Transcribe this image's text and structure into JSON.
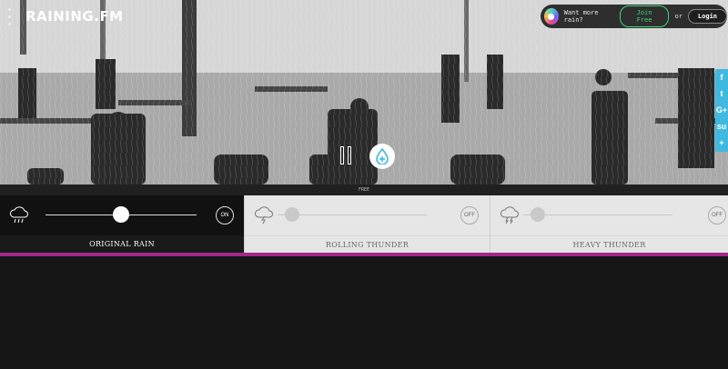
{
  "brand": {
    "logo_text": "RAINING.FM"
  },
  "account": {
    "promo_text": "Want more rain?",
    "join_label": "Join Free",
    "or_text": "or",
    "login_label": "Login"
  },
  "social": [
    "f",
    "t",
    "G+",
    "su",
    "+"
  ],
  "player": {
    "state": "playing",
    "tier_label": "FREE"
  },
  "sounds": [
    {
      "label": "ORIGINAL RAIN",
      "toggle": "ON",
      "active": true,
      "volume": 0.5,
      "icon": "rain-cloud-icon"
    },
    {
      "label": "ROLLING THUNDER",
      "toggle": "OFF",
      "active": false,
      "volume": 0.0,
      "icon": "lightning-cloud-icon"
    },
    {
      "label": "HEAVY THUNDER",
      "toggle": "OFF",
      "active": false,
      "volume": 0.0,
      "icon": "storm-cloud-icon"
    }
  ],
  "colors": {
    "accent": "#a4278c",
    "join_green": "#3ad67a",
    "social_blue": "#3fb9e0"
  }
}
